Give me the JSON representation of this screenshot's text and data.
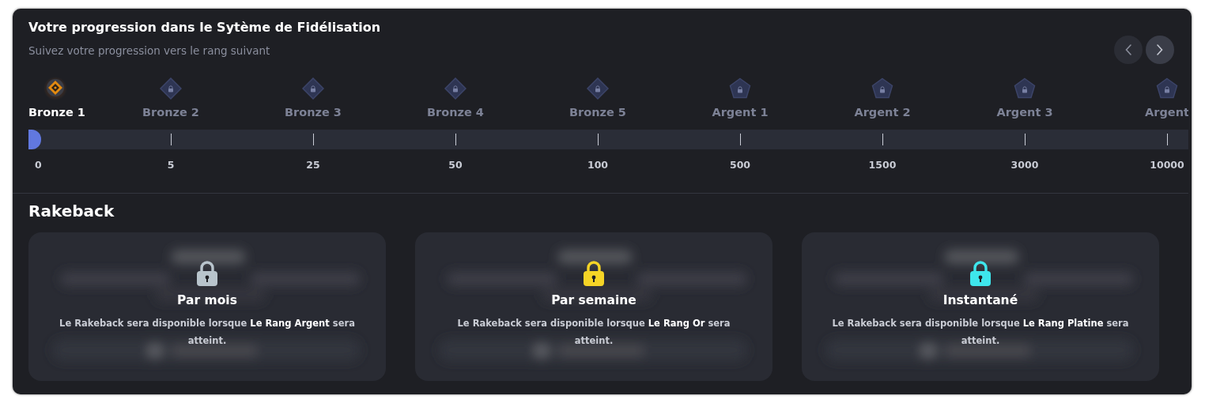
{
  "header": {
    "title": "Votre progression dans le Sytème de Fidélisation",
    "subtitle": "Suivez votre progression vers le rang suivant"
  },
  "nav": [
    {
      "disabled": true
    },
    {
      "disabled": false
    }
  ],
  "progress": {
    "level": 0.011
  },
  "ranks": [
    {
      "label": "Bronze 1",
      "value": "0",
      "kind": "bronze",
      "current": true
    },
    {
      "label": "Bronze 2",
      "value": "5",
      "kind": "bronze",
      "current": false
    },
    {
      "label": "Bronze 3",
      "value": "25",
      "kind": "bronze",
      "current": false
    },
    {
      "label": "Bronze 4",
      "value": "50",
      "kind": "bronze",
      "current": false
    },
    {
      "label": "Bronze 5",
      "value": "100",
      "kind": "bronze",
      "current": false
    },
    {
      "label": "Argent 1",
      "value": "500",
      "kind": "argent",
      "current": false
    },
    {
      "label": "Argent 2",
      "value": "1500",
      "kind": "argent",
      "current": false
    },
    {
      "label": "Argent 3",
      "value": "3000",
      "kind": "argent",
      "current": false
    },
    {
      "label": "Argent",
      "value": "10000",
      "kind": "argent",
      "current": false
    }
  ],
  "rakeback": {
    "title": "Rakeback",
    "cards": [
      {
        "title": "Par mois",
        "description": "Le Rakeback sera disponible lorsque **Le Rang Argent** sera atteint.",
        "color": "#b8c4cc"
      },
      {
        "title": "Par semaine",
        "description": "Le Rakeback sera disponible lorsque **Le Rang Or** sera atteint.",
        "color": "#f5d426"
      },
      {
        "title": "Instantané",
        "description": "Le Rakeback sera disponible lorsque **Le Rang Platine** sera atteint.",
        "color": "#3ee6ec"
      }
    ]
  }
}
